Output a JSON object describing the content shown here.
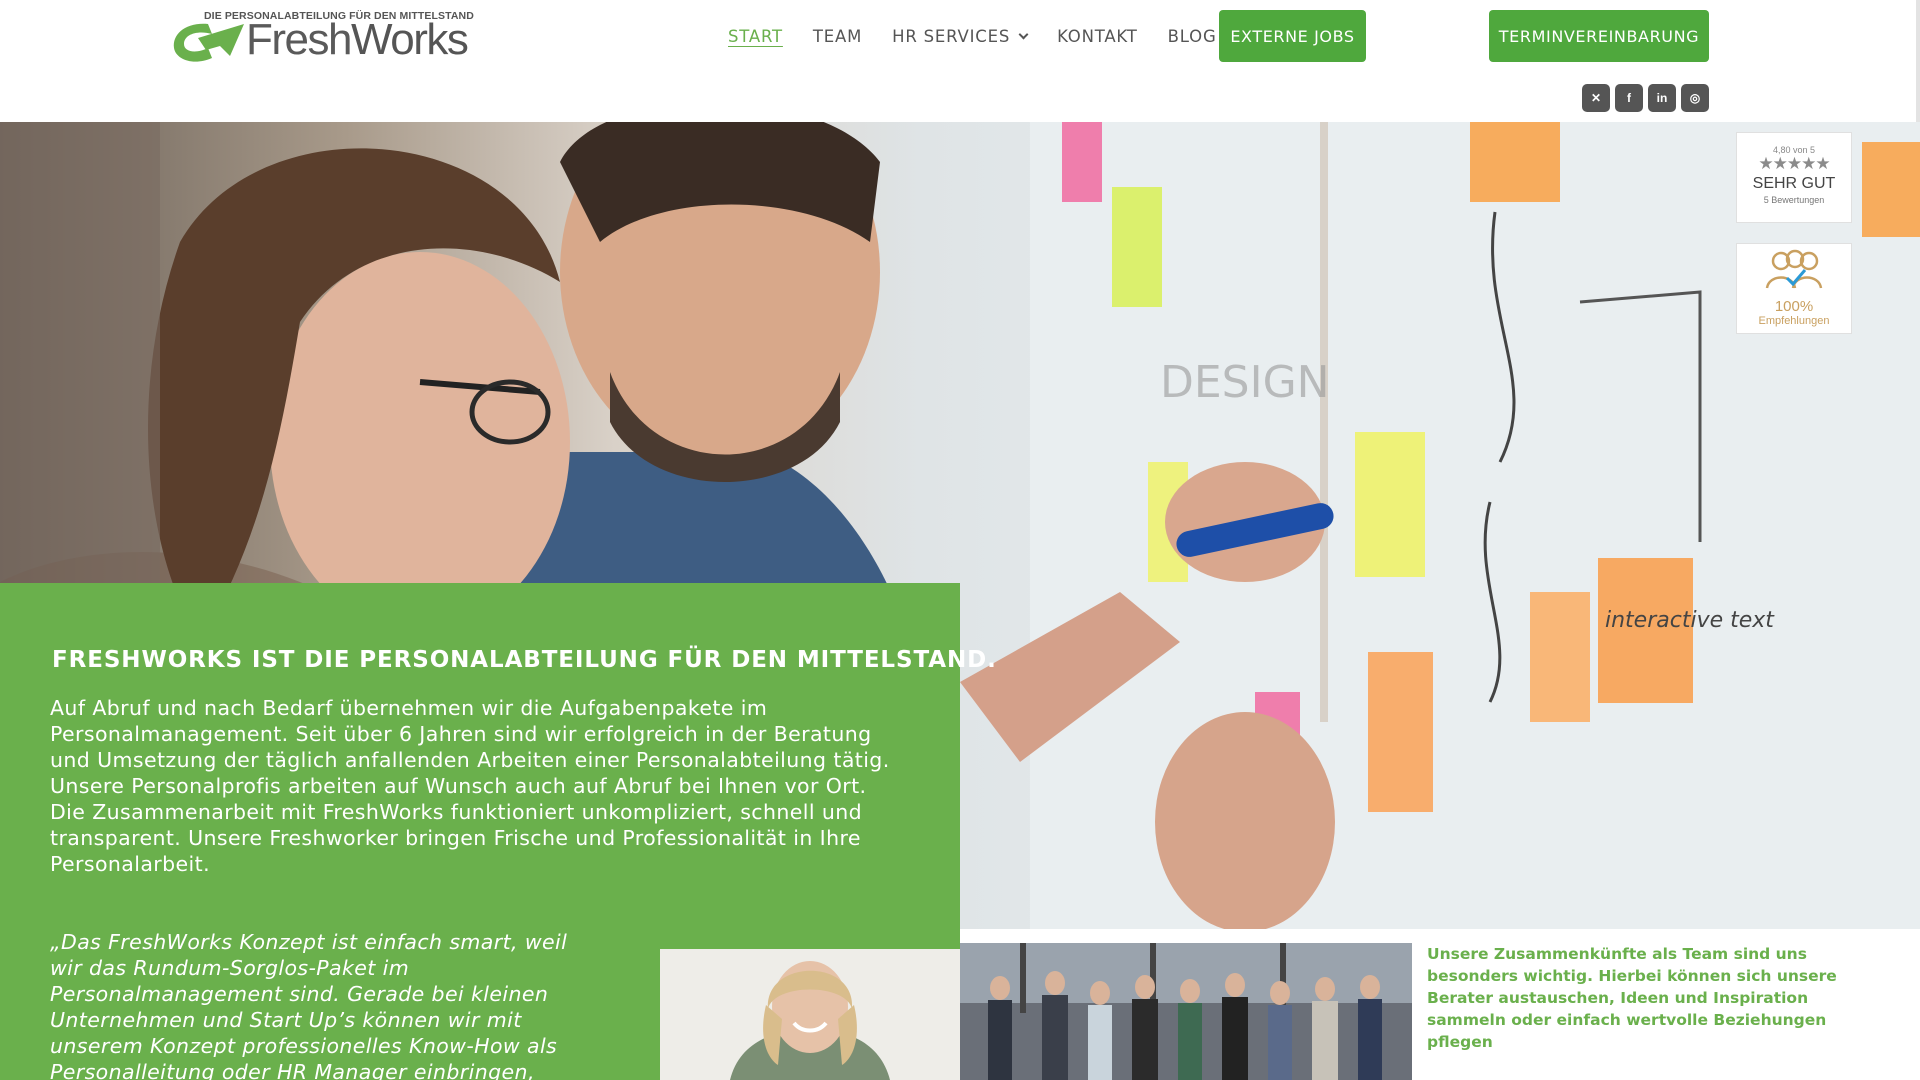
{
  "logo": {
    "tagline": "DIE PERSONALABTEILUNG FÜR DEN MITTELSTAND",
    "word_fresh": "Fresh",
    "word_works": "Works"
  },
  "nav": {
    "items": [
      {
        "label": "START",
        "active": true
      },
      {
        "label": "TEAM"
      },
      {
        "label": "HR SERVICES",
        "has_dropdown": true
      },
      {
        "label": "KONTAKT"
      },
      {
        "label": "BLOG"
      }
    ],
    "jobs_button": "EXTERNE JOBS",
    "appointment_button": "TERMINVEREINBARUNG"
  },
  "socials": [
    {
      "icon": "xing-icon",
      "glyph": "✕"
    },
    {
      "icon": "facebook-icon",
      "glyph": "f"
    },
    {
      "icon": "linkedin-icon",
      "glyph": "in"
    },
    {
      "icon": "instagram-icon",
      "glyph": "◎"
    }
  ],
  "badges": {
    "rating": {
      "score": "4,80 von 5",
      "stars": "★★★★★",
      "verdict": "SEHR GUT",
      "count": "5 Bewertungen"
    },
    "recommendation": {
      "percent": "100%",
      "label": "Empfehlungen"
    }
  },
  "hero_whiteboard": {
    "sticky_label": "interactive text",
    "board_word": "DESIGN"
  },
  "intro": {
    "title": "FRESHWORKS IST DIE PERSONALABTEILUNG FÜR DEN MITTELSTAND.",
    "text": "Auf Abruf und nach Bedarf übernehmen wir die Aufgabenpakete im Personalmanagement. Seit über 6 Jahren sind wir erfolgreich in der Beratung und Umsetzung der täglich anfallenden Arbeiten einer Personalabteilung tätig. Unsere Personalprofis arbeiten auf Wunsch auch auf Abruf bei Ihnen vor Ort. Die Zusammenarbeit mit FreshWorks funktioniert unkompliziert, schnell und transparent. Unsere Freshworker bringen Frische und Professionalität in Ihre Personalarbeit.",
    "quote": "„Das FreshWorks Konzept ist einfach smart, weil wir das Rundum-Sorglos-Paket im Personalmanagement sind. Gerade bei kleinen Unternehmen und Start Up’s können wir mit unserem Konzept professionelles Know-How als Personalleitung oder HR Manager einbringen, auch wenn es nur fünf Wochenstunden"
  },
  "team": {
    "text": "Unsere Zusammenkünfte als Team sind uns besonders wichtig. Hierbei können sich unsere Berater austauschen, Ideen und Inspiration sammeln oder einfach wertvolle Beziehungen pflegen"
  },
  "colors": {
    "brand_green": "#6ab04c",
    "button_green": "#4fa83d",
    "text_gray": "#555555"
  }
}
